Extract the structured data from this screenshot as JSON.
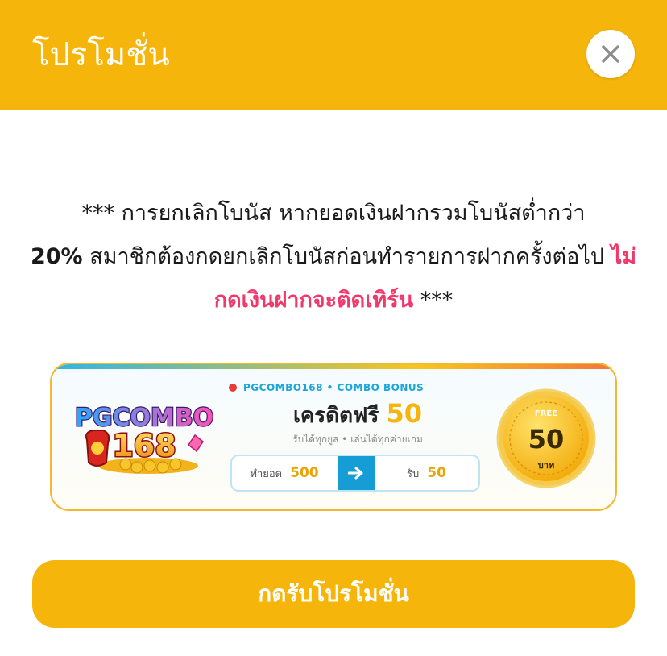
{
  "header": {
    "title": "โปรโมชั่น",
    "close_icon": "close-icon"
  },
  "notice": {
    "prefix": "*** การยกเลิกโบนัส หากยอดเงินฝากรวมโบนัสต่ำกว่า",
    "percent": "20%",
    "middle": "สมาชิกต้องกดยกเลิกโบนัสก่อนทำรายการฝากครั้งต่อไป",
    "warning": "ไม่กดเงินฝากจะติดเทิร์น",
    "suffix": "***"
  },
  "promo": {
    "logo_text_top": "PGCOMBO",
    "logo_text_bottom": "168",
    "tag": "PGCOMBO168 • COMBO BONUS",
    "credit_label": "เครดิตฟรี",
    "credit_value": "50",
    "subtitle": "รับได้ทุกยูส • เล่นได้ทุกค่ายเกม",
    "turnover_label": "ทำยอด",
    "turnover_value": "500",
    "receive_label": "รับ",
    "receive_value": "50",
    "coin_free": "FREE",
    "coin_value": "50",
    "coin_unit": "บาท"
  },
  "cta": {
    "label": "กดรับโปรโมชั่น"
  },
  "colors": {
    "brand": "#f5b50b",
    "warning": "#f0386b",
    "accent_blue": "#169dd6"
  }
}
